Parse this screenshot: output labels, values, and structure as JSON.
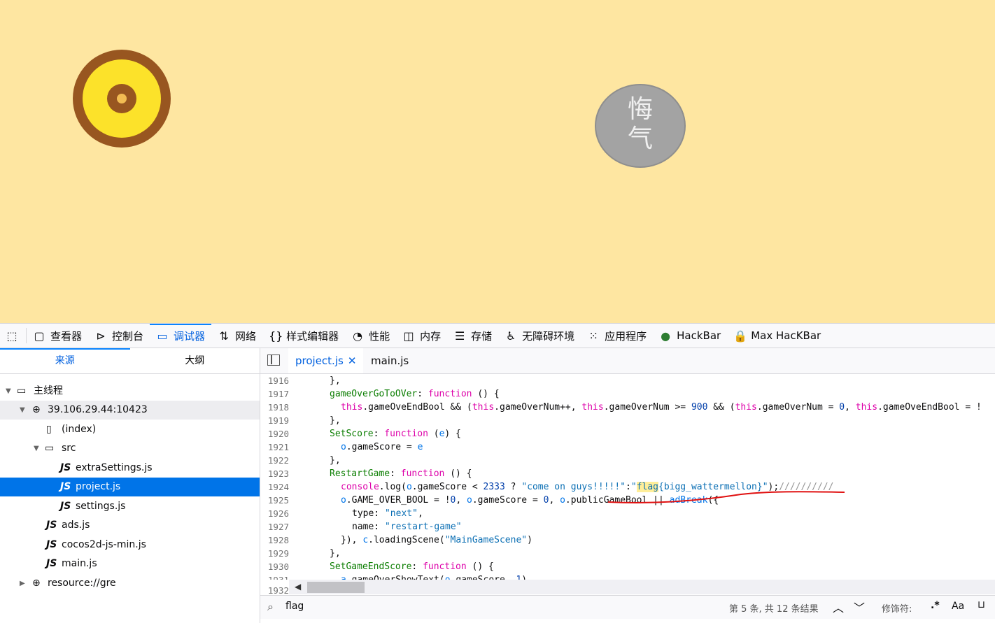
{
  "game": {
    "button_label_line1": "悔",
    "button_label_line2": "气"
  },
  "toolbar": {
    "tabs": [
      {
        "label": "查看器",
        "icon": "inspector-icon"
      },
      {
        "label": "控制台",
        "icon": "console-icon"
      },
      {
        "label": "调试器",
        "icon": "debugger-icon"
      },
      {
        "label": "网络",
        "icon": "network-icon"
      },
      {
        "label": "样式编辑器",
        "icon": "style-editor-icon"
      },
      {
        "label": "性能",
        "icon": "performance-icon"
      },
      {
        "label": "内存",
        "icon": "memory-icon"
      },
      {
        "label": "存储",
        "icon": "storage-icon"
      },
      {
        "label": "无障碍环境",
        "icon": "accessibility-icon"
      },
      {
        "label": "应用程序",
        "icon": "application-icon"
      },
      {
        "label": "HackBar",
        "icon": "hackbar-icon"
      },
      {
        "label": "Max HacKBar",
        "icon": "max-hackbar-icon"
      }
    ]
  },
  "sources": {
    "tab_sources": "来源",
    "tab_outline": "大纲",
    "main_thread": "主线程",
    "host": "39.106.29.44:10423",
    "index": "(index)",
    "src_folder": "src",
    "files_src": [
      "extraSettings.js",
      "project.js",
      "settings.js"
    ],
    "files_root": [
      "ads.js",
      "cocos2d-js-min.js",
      "main.js"
    ],
    "resource": "resource://gre",
    "js_badge": "JS"
  },
  "editor": {
    "tab_active": "project.js",
    "tab_other": "main.js",
    "line_numbers": [
      "1916",
      "1917",
      "1918",
      "1919",
      "1920",
      "1921",
      "1922",
      "1923",
      "1924",
      "1925",
      "1926",
      "1927",
      "1928",
      "1929",
      "1930",
      "1931",
      "1932"
    ]
  },
  "search": {
    "query": "flag",
    "result": "第 5 条, 共 12 条结果",
    "modifiers_label": "修饰符:",
    "regex": ".*",
    "case": "Aa"
  }
}
